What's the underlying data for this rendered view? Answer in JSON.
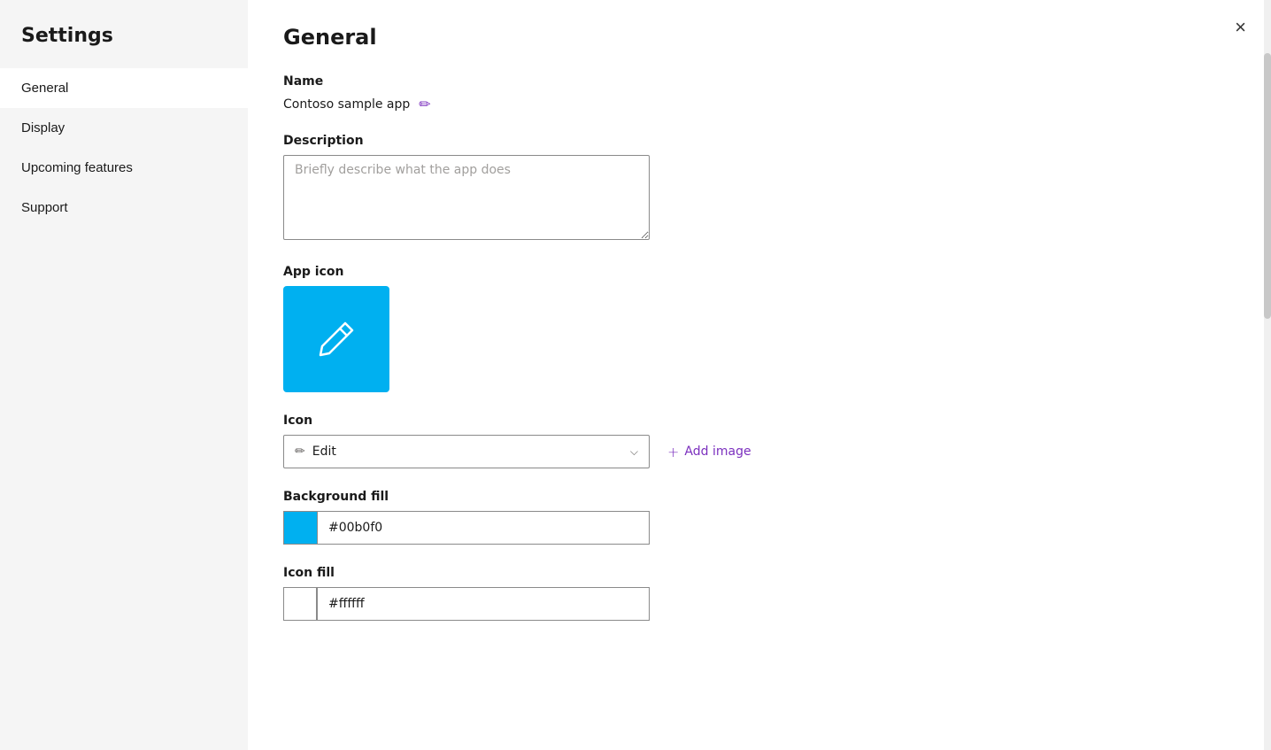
{
  "sidebar": {
    "title": "Settings",
    "items": [
      {
        "id": "general",
        "label": "General",
        "active": true
      },
      {
        "id": "display",
        "label": "Display",
        "active": false
      },
      {
        "id": "upcoming-features",
        "label": "Upcoming features",
        "active": false
      },
      {
        "id": "support",
        "label": "Support",
        "active": false
      }
    ]
  },
  "main": {
    "page_title": "General",
    "sections": {
      "name": {
        "label": "Name",
        "value": "Contoso sample app",
        "edit_aria": "Edit name"
      },
      "description": {
        "label": "Description",
        "placeholder": "Briefly describe what the app does"
      },
      "app_icon": {
        "label": "App icon",
        "bg_color": "#00b0f0"
      },
      "icon": {
        "label": "Icon",
        "selected": "Edit",
        "add_image_label": "Add image"
      },
      "background_fill": {
        "label": "Background fill",
        "color": "#00b0f0",
        "color_hex": "#00b0f0"
      },
      "icon_fill": {
        "label": "Icon fill",
        "color": "#ffffff",
        "color_hex": "#ffffff"
      }
    },
    "close_label": "×"
  },
  "icons": {
    "pencil": "✏",
    "plus": "+",
    "chevron_down": "⌄",
    "close": "✕"
  },
  "colors": {
    "accent_purple": "#7b2fbe",
    "icon_bg": "#00b0f0"
  }
}
